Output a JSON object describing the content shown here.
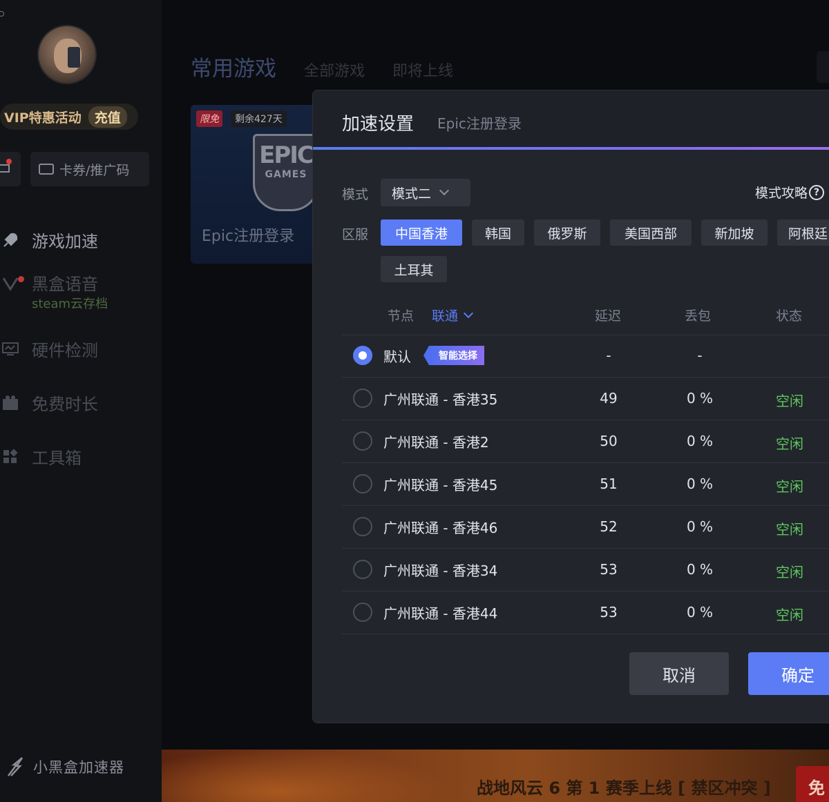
{
  "sidebar": {
    "vip_text": "VIP特惠活动",
    "recharge": "充值",
    "coupon_label": "卡券/推广码",
    "nav": [
      {
        "label": "游戏加速",
        "icon": "rocket-icon"
      },
      {
        "label": "黑盒语音",
        "icon": "voice-icon",
        "sub": "steam云存档"
      },
      {
        "label": "硬件检测",
        "icon": "monitor-icon"
      },
      {
        "label": "免费时长",
        "icon": "gift-icon"
      },
      {
        "label": "工具箱",
        "icon": "toolbox-icon"
      }
    ],
    "brand": "小黑盒加速器"
  },
  "main": {
    "tabs": [
      "常用游戏",
      "全部游戏",
      "即将上线"
    ],
    "card": {
      "tag_free": "限免",
      "tag_days": "剩余427天",
      "logo_line1": "EPIC",
      "logo_line2": "GAMES",
      "name": "Epic注册登录"
    },
    "banner": {
      "text": "战地风云 6 第 1 赛季上线 [ 禁区冲突 ]",
      "free": "免"
    }
  },
  "dialog": {
    "title": "加速设置",
    "subtitle": "Epic注册登录",
    "mode_label": "模式",
    "mode_value": "模式二",
    "mode_guide": "模式攻略",
    "region_label": "区服",
    "regions": [
      "中国香港",
      "韩国",
      "俄罗斯",
      "美国西部",
      "新加坡",
      "阿根廷",
      "土耳其"
    ],
    "active_region": "中国香港",
    "table": {
      "node_label": "节点",
      "isp": "联通",
      "latency": "延迟",
      "loss": "丢包",
      "status": "状态"
    },
    "default_row": {
      "name": "默认",
      "tag": "智能选择",
      "latency": "-",
      "loss": "-",
      "status": ""
    },
    "nodes": [
      {
        "name": "广州联通 - 香港35",
        "latency": "49",
        "loss": "0 %",
        "status": "空闲"
      },
      {
        "name": "广州联通 - 香港2",
        "latency": "50",
        "loss": "0 %",
        "status": "空闲"
      },
      {
        "name": "广州联通 - 香港45",
        "latency": "51",
        "loss": "0 %",
        "status": "空闲"
      },
      {
        "name": "广州联通 - 香港46",
        "latency": "52",
        "loss": "0 %",
        "status": "空闲"
      },
      {
        "name": "广州联通 - 香港34",
        "latency": "53",
        "loss": "0 %",
        "status": "空闲"
      },
      {
        "name": "广州联通 - 香港44",
        "latency": "53",
        "loss": "0 %",
        "status": "空闲"
      }
    ],
    "cancel": "取消",
    "confirm": "确定"
  },
  "colors": {
    "accent": "#5b7cf5",
    "status_ok": "#5ec85e",
    "vip_gold": "#d8b98a"
  }
}
